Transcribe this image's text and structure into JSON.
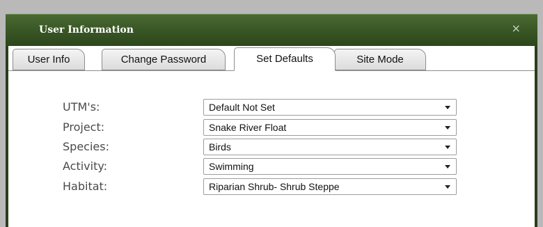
{
  "dialog": {
    "title": "User Information",
    "close_glyph": "×"
  },
  "tabs": [
    {
      "label": "User Info"
    },
    {
      "label": "Change Password"
    },
    {
      "label": "Set Defaults"
    },
    {
      "label": "Site Mode"
    }
  ],
  "active_tab": "Set Defaults",
  "fields": [
    {
      "label": "UTM's:",
      "value": "Default Not Set"
    },
    {
      "label": "Project:",
      "value": "Snake River Float"
    },
    {
      "label": "Species:",
      "value": "Birds"
    },
    {
      "label": "Activity:",
      "value": "Swimming"
    },
    {
      "label": "Habitat:",
      "value": "Riparian Shrub- Shrub Steppe"
    }
  ],
  "colors": {
    "titlebar": "#3a5826",
    "frame": "#2a3d1c",
    "label_text": "#4a4a4a"
  },
  "icons": {
    "close": "close-icon",
    "dropdown": "chevron-down-icon"
  }
}
